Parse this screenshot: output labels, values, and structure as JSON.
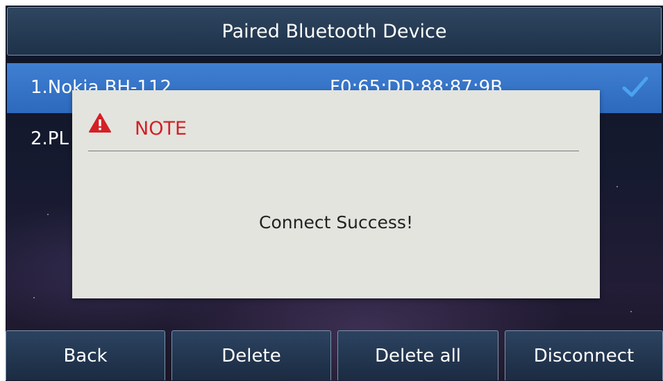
{
  "header": {
    "title": "Paired Bluetooth Device"
  },
  "devices": [
    {
      "label": "1.Nokia BH-112",
      "mac": "F0:65:DD:88:87:9B",
      "selected": true
    },
    {
      "label": "2.PL",
      "mac": "",
      "selected": false
    }
  ],
  "dialog": {
    "heading": "NOTE",
    "message": "Connect Success!",
    "icon": "warning-icon",
    "heading_color": "#d42027"
  },
  "softkeys": [
    "Back",
    "Delete",
    "Delete all",
    "Disconnect"
  ],
  "colors": {
    "selection": "#3f7fd1",
    "checkmark": "#4aa3f0",
    "dialog_bg": "#e3e4de"
  }
}
